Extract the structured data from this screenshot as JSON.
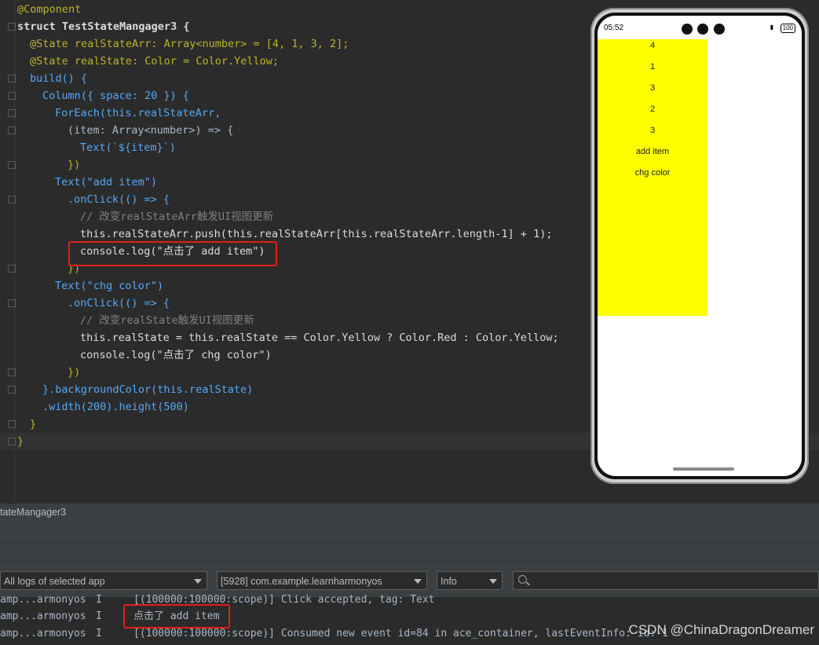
{
  "editor": {
    "lines": [
      "@Component",
      "struct TestStateMangager3 {",
      "@State realStateArr: Array<number> = [4, 1, 3, 2];",
      "@State realState: Color = Color.Yellow;",
      "build() {",
      "Column({ space: 20 }) {",
      "ForEach(this.realStateArr,",
      "(item: Array<number>) => {",
      "Text(`${item}`)",
      "})",
      "Text(\"add item\")",
      ".onClick(() => {",
      "// 改变realStateArr触发UI视图更新",
      "this.realStateArr.push(this.realStateArr[this.realStateArr.length-1] + 1);",
      "console.log(\"点击了 add item\")",
      "})",
      "Text(\"chg color\")",
      ".onClick(() => {",
      "// 改变realState触发UI视图更新",
      "this.realState = this.realState == Color.Yellow ? Color.Red : Color.Yellow;",
      "console.log(\"点击了 chg color\")",
      "})",
      "}.backgroundColor(this.realState)",
      ".width(200).height(500)",
      "}",
      "}"
    ]
  },
  "phone": {
    "time": "05:52",
    "battery": "100",
    "items": [
      "4",
      "1",
      "3",
      "2",
      "3"
    ],
    "add_item_label": "add item",
    "chg_color_label": "chg color",
    "column_color": "#ffff00"
  },
  "panel": {
    "title": "tateMangager3",
    "filter_logs": "All logs of selected app",
    "process": "[5928] com.example.learnharmonyos",
    "level": "Info",
    "search_placeholder": ""
  },
  "logs": [
    {
      "tag": "amp...armonyos",
      "level": "I",
      "message": "[(100000:100000:scope)] Click accepted, tag: Text"
    },
    {
      "tag": "amp...armonyos",
      "level": "I",
      "message": "点击了 add item"
    },
    {
      "tag": "amp...armonyos",
      "level": "I",
      "message": "[(100000:100000:scope)] Consumed new event id=84 in ace_container, lastEventInfo: id:-1"
    }
  ],
  "watermark": "CSDN @ChinaDragonDreamer",
  "colors": {
    "accent_red": "#e0201a",
    "editor_bg": "#2b2b2b"
  }
}
